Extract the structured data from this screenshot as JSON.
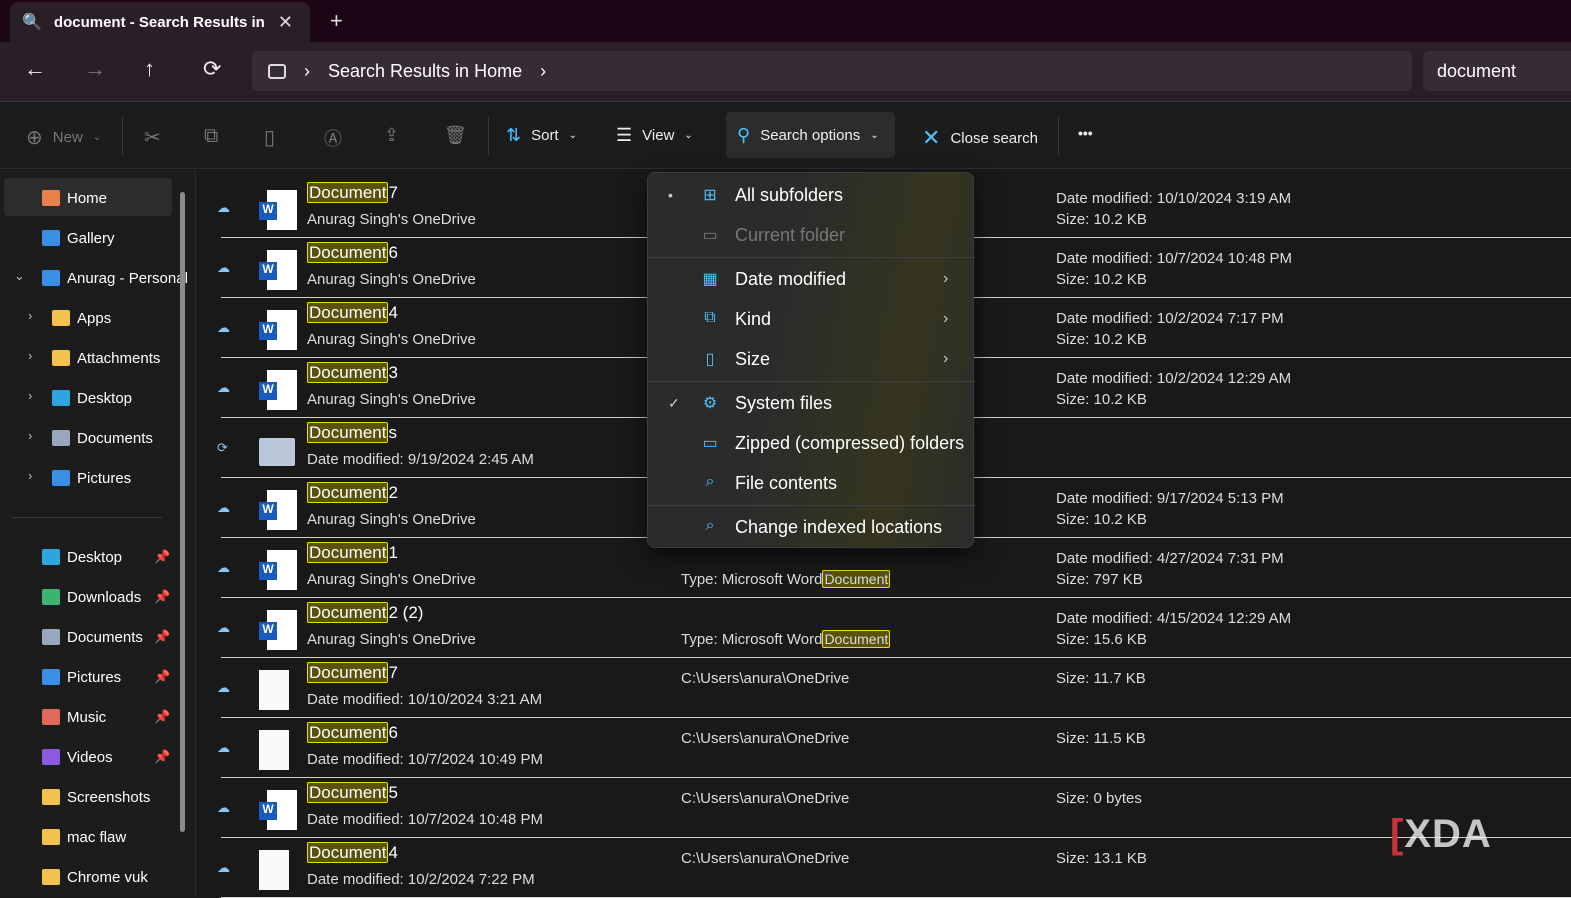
{
  "tab": {
    "title": "document - Search Results in Home",
    "close": "✕",
    "new_tab": "+"
  },
  "nav": {
    "back": "←",
    "forward": "→",
    "up": "↑",
    "refresh": "⟳",
    "breadcrumb": "Search Results in Home",
    "sep": "›",
    "search_value": "document"
  },
  "toolbar": {
    "new": "New",
    "sort": "Sort",
    "view": "View",
    "search_options": "Search options",
    "close_search": "Close search",
    "more": "•••"
  },
  "sidebar": {
    "items": [
      {
        "label": "Home",
        "color": "#e8824a"
      },
      {
        "label": "Gallery",
        "color": "#3a8ee6"
      },
      {
        "label": "Anurag - Personal",
        "color": "#3a8ee6"
      },
      {
        "label": "Apps",
        "color": "#f2c14e"
      },
      {
        "label": "Attachments",
        "color": "#f2c14e"
      },
      {
        "label": "Desktop",
        "color": "#2fa5e0"
      },
      {
        "label": "Documents",
        "color": "#9aa8bd"
      },
      {
        "label": "Pictures",
        "color": "#3a8ee6"
      }
    ],
    "pinned": [
      {
        "label": "Desktop",
        "color": "#2fa5e0",
        "pinned": true
      },
      {
        "label": "Downloads",
        "color": "#3cb371",
        "pinned": true
      },
      {
        "label": "Documents",
        "color": "#9aa8bd",
        "pinned": true
      },
      {
        "label": "Pictures",
        "color": "#3a8ee6",
        "pinned": true
      },
      {
        "label": "Music",
        "color": "#e06a5a",
        "pinned": true
      },
      {
        "label": "Videos",
        "color": "#8a5ae0",
        "pinned": true
      },
      {
        "label": "Screenshots",
        "color": "#f2c14e"
      },
      {
        "label": "mac flaw",
        "color": "#f2c14e"
      },
      {
        "label": "Chrome vuk",
        "color": "#f2c14e"
      }
    ]
  },
  "files": [
    {
      "match": "Document",
      "rest": "7",
      "sub": "Anurag Singh's OneDrive",
      "icon": "word-shortcut",
      "r1": "Date modified: 10/10/2024 3:19 AM",
      "r2": "Size: 10.2 KB"
    },
    {
      "match": "Document",
      "rest": "6",
      "sub": "Anurag Singh's OneDrive",
      "icon": "word-shortcut",
      "r1": "Date modified: 10/7/2024 10:48 PM",
      "r2": "Size: 10.2 KB"
    },
    {
      "match": "Document",
      "rest": "4",
      "sub": "Anurag Singh's OneDrive",
      "icon": "word-shortcut",
      "r1": "Date modified: 10/2/2024 7:17 PM",
      "r2": "Size: 10.2 KB"
    },
    {
      "match": "Document",
      "rest": "3",
      "sub": "Anurag Singh's OneDrive",
      "icon": "word-shortcut",
      "r1": "Date modified: 10/2/2024 12:29 AM",
      "r2": "Size: 10.2 KB"
    },
    {
      "match": "Document",
      "rest": "s",
      "sub": "Date modified: 9/19/2024 2:45 AM",
      "icon": "folder",
      "sync": true
    },
    {
      "match": "Document",
      "rest": "2",
      "sub": "Anurag Singh's OneDrive",
      "icon": "word-shortcut",
      "r1": "Date modified: 9/17/2024 5:13 PM",
      "r2": "Size: 10.2 KB"
    },
    {
      "match": "Document",
      "rest": "1",
      "sub": "Anurag Singh's OneDrive",
      "icon": "word-shortcut",
      "type": "Type: Microsoft Word",
      "type_match": "Document",
      "r1": "Date modified: 4/27/2024 7:31 PM",
      "r2": "Size: 797 KB"
    },
    {
      "match": "Document",
      "rest": "2 (2)",
      "sub": "Anurag Singh's OneDrive",
      "icon": "word-shortcut",
      "type": "Type: Microsoft Word",
      "type_match": "Document",
      "r1": "Date modified: 4/15/2024 12:29 AM",
      "r2": "Size: 15.6 KB"
    },
    {
      "match": "Document",
      "rest": "7",
      "sub": "Date modified: 10/10/2024 3:21 AM",
      "icon": "doc-thumb",
      "path": "C:\\Users\\anura\\OneDrive",
      "r1": "Size: 11.7 KB"
    },
    {
      "match": "Document",
      "rest": "6",
      "sub": "Date modified: 10/7/2024 10:49 PM",
      "icon": "doc-thumb",
      "path": "C:\\Users\\anura\\OneDrive",
      "r1": "Size: 11.5 KB"
    },
    {
      "match": "Document",
      "rest": "5",
      "sub": "Date modified: 10/7/2024 10:48 PM",
      "icon": "word",
      "path": "C:\\Users\\anura\\OneDrive",
      "r1": "Size: 0 bytes"
    },
    {
      "match": "Document",
      "rest": "4",
      "sub": "Date modified: 10/2/2024 7:22 PM",
      "icon": "doc-thumb",
      "path": "C:\\Users\\anura\\OneDrive",
      "r1": "Size: 13.1 KB"
    }
  ],
  "menu": [
    {
      "label": "All subfolders",
      "icon": "subfolders-icon",
      "glyph": "⊞",
      "mark": "•"
    },
    {
      "label": "Current folder",
      "icon": "folder-icon",
      "glyph": "▭",
      "disabled": true
    },
    {
      "sep": true
    },
    {
      "label": "Date modified",
      "icon": "calendar-icon",
      "glyph": "▦",
      "arrow": "›"
    },
    {
      "label": "Kind",
      "icon": "kind-icon",
      "glyph": "⧉",
      "arrow": "›"
    },
    {
      "label": "Size",
      "icon": "size-icon",
      "glyph": "▯",
      "arrow": "›"
    },
    {
      "sep": true
    },
    {
      "label": "System files",
      "icon": "system-file-icon",
      "glyph": "⚙",
      "mark": "✓"
    },
    {
      "label": "Zipped (compressed) folders",
      "icon": "zip-folder-icon",
      "glyph": "▭"
    },
    {
      "label": "File contents",
      "icon": "file-search-icon",
      "glyph": "⌕"
    },
    {
      "sep": true
    },
    {
      "label": "Change indexed locations",
      "icon": "index-icon",
      "glyph": "⌕"
    }
  ],
  "watermark": "XDA",
  "accent": "#4cc2ff",
  "highlight": "#e8e000"
}
